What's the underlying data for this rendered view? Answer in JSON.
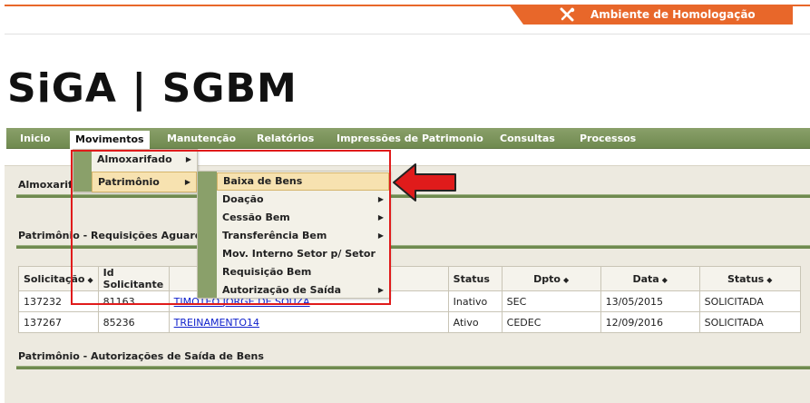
{
  "environment": {
    "label": "Ambiente de Homologação",
    "icon": "tools-icon"
  },
  "logo": {
    "text": "SiGA | SGBM"
  },
  "nav": {
    "items": [
      {
        "label": "Inicio"
      },
      {
        "label": "Movimentos",
        "active": true
      },
      {
        "label": "Manutenção"
      },
      {
        "label": "Relatórios"
      },
      {
        "label": "Impressões de Patrimonio"
      },
      {
        "label": "Consultas"
      },
      {
        "label": "Processos"
      }
    ]
  },
  "menu_movimentos": {
    "items": [
      {
        "label": "Almoxarifado"
      },
      {
        "label": "Patrimônio"
      }
    ]
  },
  "menu_patrimonio": {
    "items": [
      {
        "label": "Baixa de Bens"
      },
      {
        "label": "Doação"
      },
      {
        "label": "Cessão Bem"
      },
      {
        "label": "Transferência Bem"
      },
      {
        "label": "Mov. Interno Setor p/ Setor"
      },
      {
        "label": "Requisição Bem"
      },
      {
        "label": "Autorização de Saída"
      }
    ]
  },
  "sections": {
    "almox_title": "Almoxarifa",
    "requisicoes_title": "Patrimônio - Requisições Aguardand",
    "autorizacoes_title": "Patrimônio - Autorizações de Saída de Bens"
  },
  "table": {
    "headers": [
      "Solicitação",
      "Id Solicitante",
      "",
      "Status",
      "Dpto",
      "Data",
      "Status"
    ],
    "rows": [
      [
        "137232",
        "81163",
        "TIMOTEO JORGE DE SOUZA",
        "Inativo",
        "SEC",
        "13/05/2015",
        "SOLICITADA"
      ],
      [
        "137267",
        "85236",
        "TREINAMENTO14",
        "Ativo",
        "CEDEC",
        "12/09/2016",
        "SOLICITADA"
      ]
    ]
  },
  "colors": {
    "accent_orange": "#e8672a",
    "nav_green": "#6f8a4f",
    "annotation_red": "#e01b1b"
  }
}
